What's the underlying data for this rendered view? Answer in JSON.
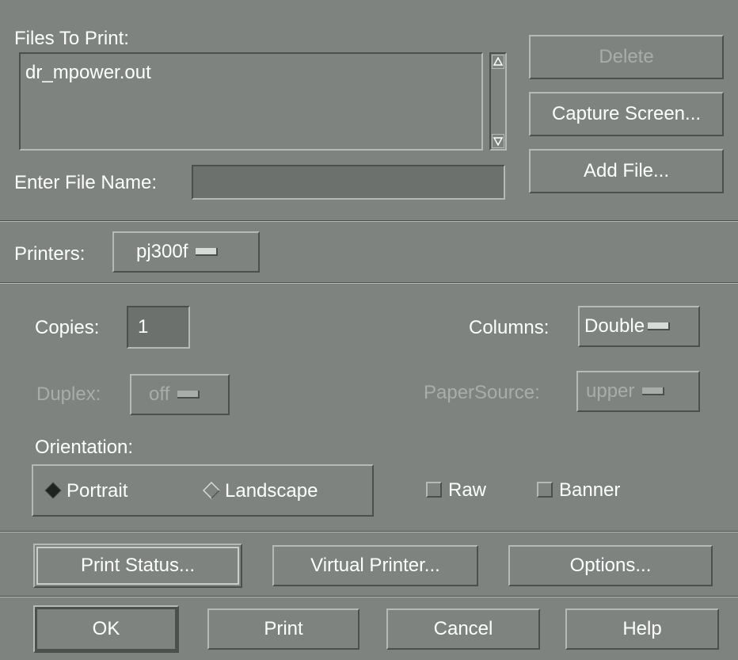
{
  "files": {
    "label": "Files To Print:",
    "items": [
      "dr_mpower.out"
    ],
    "delete_label": "Delete",
    "capture_label": "Capture Screen...",
    "add_label": "Add File...",
    "enter_label": "Enter File Name:",
    "enter_value": ""
  },
  "printers": {
    "label": "Printers:",
    "value": "pj300f"
  },
  "options": {
    "copies_label": "Copies:",
    "copies_value": "1",
    "columns_label": "Columns:",
    "columns_value": "Double",
    "duplex_label": "Duplex:",
    "duplex_value": "off",
    "papersource_label": "PaperSource:",
    "papersource_value": "upper",
    "orientation_label": "Orientation:",
    "portrait_label": "Portrait",
    "landscape_label": "Landscape",
    "orientation_selected": "Portrait",
    "raw_label": "Raw",
    "banner_label": "Banner"
  },
  "actions": {
    "print_status": "Print Status...",
    "virtual_printer": "Virtual Printer...",
    "options": "Options..."
  },
  "footer": {
    "ok": "OK",
    "print": "Print",
    "cancel": "Cancel",
    "help": "Help"
  }
}
